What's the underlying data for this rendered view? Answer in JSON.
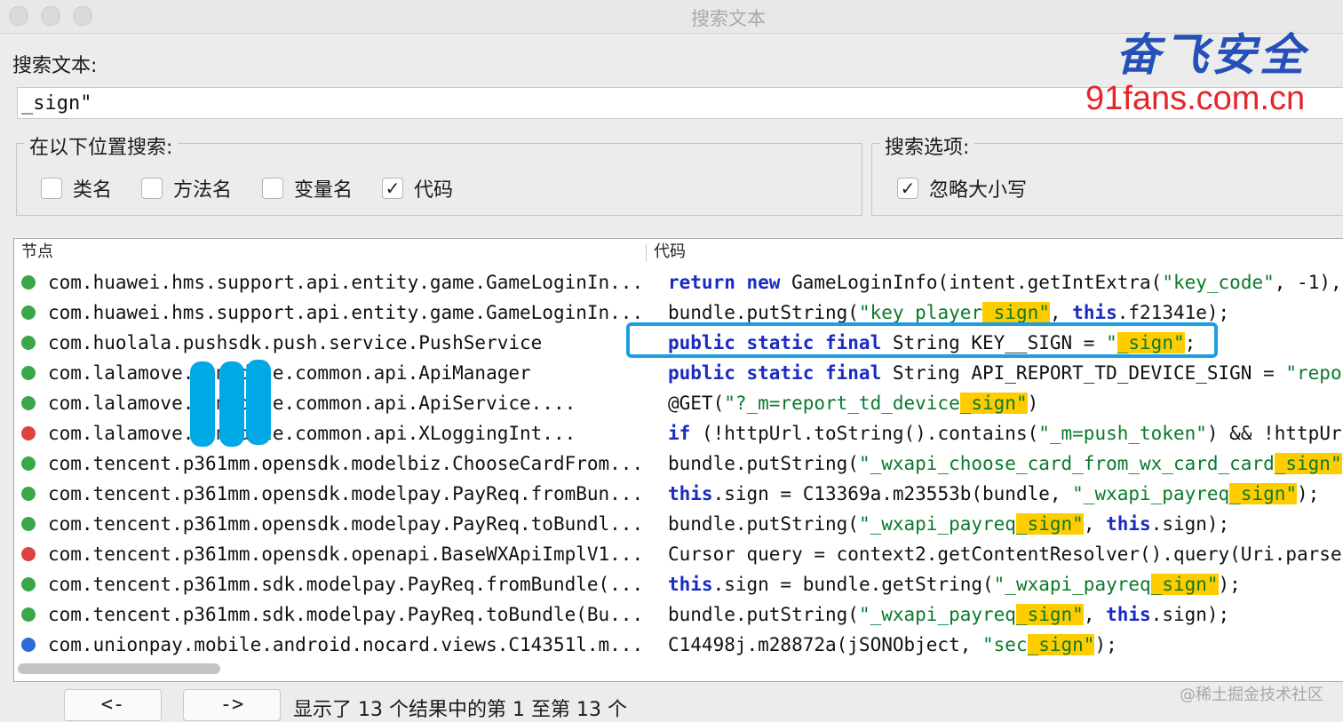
{
  "window": {
    "title": "搜索文本"
  },
  "search": {
    "label": "搜索文本:",
    "value": "_sign\""
  },
  "location_group": {
    "title": "在以下位置搜索:",
    "options": [
      {
        "label": "类名",
        "checked": false
      },
      {
        "label": "方法名",
        "checked": false
      },
      {
        "label": "变量名",
        "checked": false
      },
      {
        "label": "代码",
        "checked": true
      }
    ]
  },
  "options_group": {
    "title": "搜索选项:",
    "options": [
      {
        "label": "忽略大小写",
        "checked": true
      }
    ]
  },
  "results": {
    "columns": {
      "node": "节点",
      "code": "代码"
    },
    "rows": [
      {
        "icon": "method-icon",
        "icon_color": "#3aa84a",
        "node": "com.huawei.hms.support.api.entity.game.GameLoginIn...",
        "code": [
          [
            "kw",
            "return"
          ],
          [
            "t",
            " "
          ],
          [
            "kw",
            "new"
          ],
          [
            "t",
            " GameLoginInfo(intent.getIntExtra("
          ],
          [
            "s",
            "\"key_code\""
          ],
          [
            "t",
            ", -1), "
          ]
        ]
      },
      {
        "icon": "method-icon",
        "icon_color": "#3aa84a",
        "node": "com.huawei.hms.support.api.entity.game.GameLoginIn...",
        "code": [
          [
            "t",
            "bundle.putString("
          ],
          [
            "s",
            "\"key_player"
          ],
          [
            "h",
            "_sign\""
          ],
          [
            "t",
            ", "
          ],
          [
            "kw",
            "this"
          ],
          [
            "t",
            ".f21341e);"
          ]
        ]
      },
      {
        "icon": "class-icon",
        "icon_color": "#3aa84a",
        "node": "com.huolala.pushsdk.push.service.PushService",
        "code": [
          [
            "kw",
            "public static final"
          ],
          [
            "t",
            " String KEY__SIGN = "
          ],
          [
            "s",
            "\""
          ],
          [
            "h",
            "_sign\""
          ],
          [
            "t",
            ";"
          ]
        ]
      },
      {
        "icon": "class-icon",
        "icon_color": "#3aa84a",
        "node": "com.lalamove.        .module.common.api.ApiManager",
        "code": [
          [
            "kw",
            "public static final"
          ],
          [
            "t",
            " String API_REPORT_TD_DEVICE_SIGN = "
          ],
          [
            "s",
            "\"repor"
          ]
        ]
      },
      {
        "icon": "interface-icon",
        "icon_color": "#3aa84a",
        "node": "com.lalamove.        .module.common.api.ApiService....",
        "code": [
          [
            "t",
            "@GET("
          ],
          [
            "s",
            "\"?_m=report_td_device"
          ],
          [
            "h",
            "_sign\""
          ],
          [
            "t",
            ")"
          ]
        ]
      },
      {
        "icon": "static-icon",
        "icon_color": "#e04040",
        "node": "com.lalamove.        .module.common.api.XLoggingInt...",
        "code": [
          [
            "kw",
            "if"
          ],
          [
            "t",
            " (!httpUrl.toString().contains("
          ],
          [
            "s",
            "\"_m=push_token\""
          ],
          [
            "t",
            ") && !httpUrl"
          ]
        ]
      },
      {
        "icon": "method-icon",
        "icon_color": "#3aa84a",
        "node": "com.tencent.p361mm.opensdk.modelbiz.ChooseCardFrom...",
        "code": [
          [
            "t",
            "bundle.putString("
          ],
          [
            "s",
            "\"_wxapi_choose_card_from_wx_card_card"
          ],
          [
            "h",
            "_sign\""
          ],
          [
            "t",
            ", "
          ]
        ]
      },
      {
        "icon": "method-icon",
        "icon_color": "#3aa84a",
        "node": "com.tencent.p361mm.opensdk.modelpay.PayReq.fromBun...",
        "code": [
          [
            "kw",
            "this"
          ],
          [
            "t",
            ".sign = C13369a.m23553b(bundle, "
          ],
          [
            "s",
            "\"_wxapi_payreq"
          ],
          [
            "h",
            "_sign\""
          ],
          [
            "t",
            ");"
          ]
        ]
      },
      {
        "icon": "method-icon",
        "icon_color": "#3aa84a",
        "node": "com.tencent.p361mm.opensdk.modelpay.PayReq.toBundl...",
        "code": [
          [
            "t",
            "bundle.putString("
          ],
          [
            "s",
            "\"_wxapi_payreq"
          ],
          [
            "h",
            "_sign\""
          ],
          [
            "t",
            ", "
          ],
          [
            "kw",
            "this"
          ],
          [
            "t",
            ".sign);"
          ]
        ]
      },
      {
        "icon": "private-method-icon",
        "icon_color": "#e04040",
        "node": "com.tencent.p361mm.opensdk.openapi.BaseWXApiImplV1...",
        "code": [
          [
            "t",
            "Cursor query = context2.getContentResolver().query(Uri.parse("
          ]
        ]
      },
      {
        "icon": "method-icon",
        "icon_color": "#3aa84a",
        "node": "com.tencent.p361mm.sdk.modelpay.PayReq.fromBundle(...",
        "code": [
          [
            "kw",
            "this"
          ],
          [
            "t",
            ".sign = bundle.getString("
          ],
          [
            "s",
            "\"_wxapi_payreq"
          ],
          [
            "h",
            "_sign\""
          ],
          [
            "t",
            ");"
          ]
        ]
      },
      {
        "icon": "method-icon",
        "icon_color": "#3aa84a",
        "node": "com.tencent.p361mm.sdk.modelpay.PayReq.toBundle(Bu...",
        "code": [
          [
            "t",
            "bundle.putString("
          ],
          [
            "s",
            "\"_wxapi_payreq"
          ],
          [
            "h",
            "_sign\""
          ],
          [
            "t",
            ", "
          ],
          [
            "kw",
            "this"
          ],
          [
            "t",
            ".sign);"
          ]
        ]
      },
      {
        "icon": "final-icon",
        "icon_color": "#2d6bd6",
        "node": "com.unionpay.mobile.android.nocard.views.C14351l.m...",
        "code": [
          [
            "t",
            "C14498j.m28872a(jSONObject, "
          ],
          [
            "s",
            "\"sec"
          ],
          [
            "h",
            "_sign\""
          ],
          [
            "t",
            ");"
          ]
        ]
      }
    ]
  },
  "nav": {
    "prev": "<-",
    "next": "->"
  },
  "status": "显示了 13 个结果中的第 1 至第 13 个",
  "watermark": {
    "brand": "奋飞安全",
    "url": "91fans.com.cn",
    "footer": "@稀土掘金技术社区"
  }
}
